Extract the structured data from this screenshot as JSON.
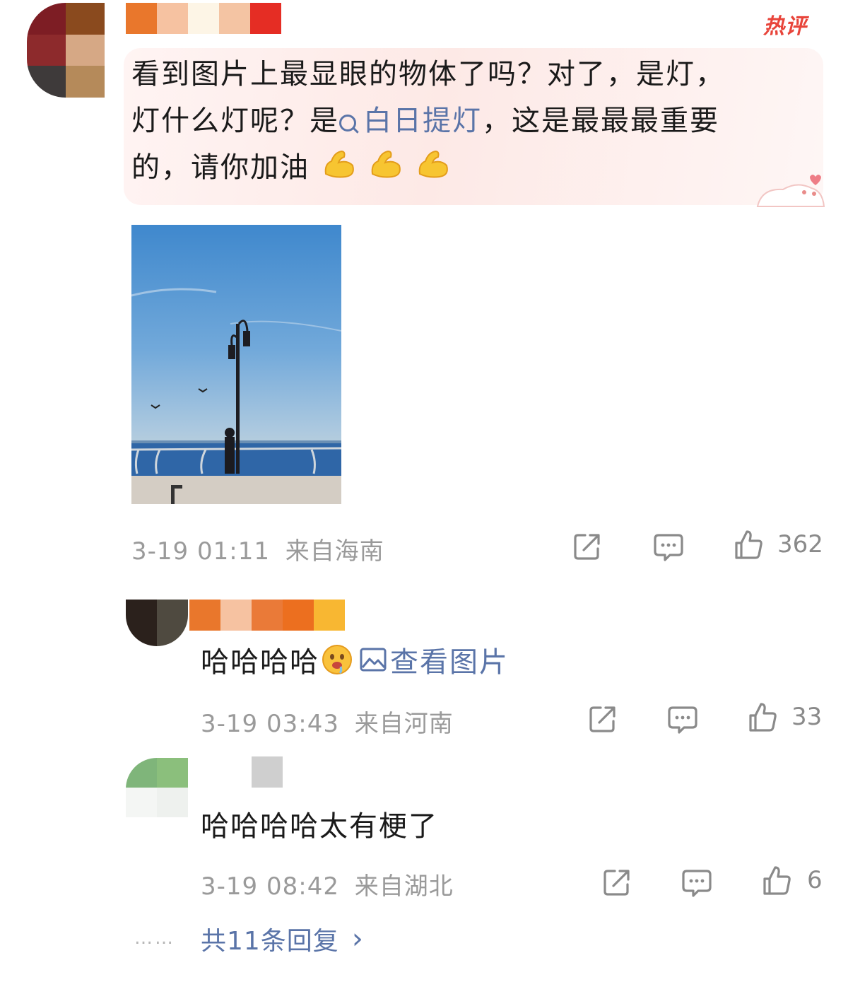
{
  "main_comment": {
    "hot_badge": "热评",
    "text_line1": "看到图片上最显眼的物体了吗？对了，是灯，",
    "text_line2_prefix": "灯什么灯呢？是",
    "topic": "白日提灯",
    "text_line2_suffix": "，这是最最最重要",
    "text_line3": "的，请你加油",
    "emojis": [
      "flexed-biceps",
      "flexed-biceps",
      "flexed-biceps"
    ],
    "timestamp": "3-19 01:11",
    "location": "来自海南",
    "like_count": "362"
  },
  "replies": [
    {
      "text": "哈哈哈哈",
      "emoji": "drooling-face",
      "view_image_label": "查看图片",
      "timestamp": "3-19 03:43",
      "location": "来自河南",
      "like_count": "33"
    },
    {
      "text": "哈哈哈哈太有梗了",
      "timestamp": "3-19 08:42",
      "location": "来自湖北",
      "like_count": "6"
    }
  ],
  "more_replies": {
    "dots": "……",
    "label": "共11条回复",
    "chevron": "›"
  },
  "icons": {
    "share": "share-icon",
    "comment": "comment-icon",
    "like": "thumbs-up-icon"
  },
  "colors": {
    "link": "#5a74a8",
    "hot": "#e8443a",
    "meta": "#9a9a9a"
  }
}
